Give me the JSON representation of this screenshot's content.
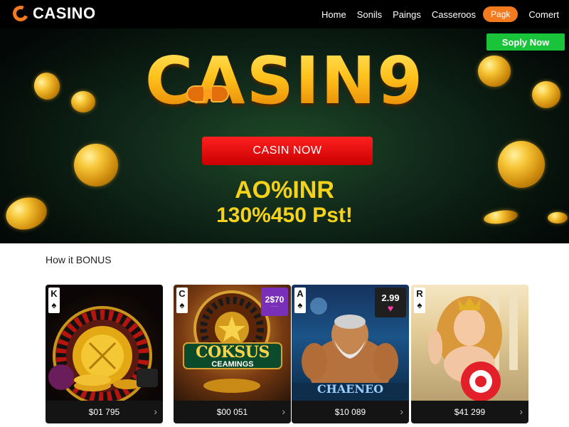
{
  "nav": {
    "brand": "CASINO",
    "links": [
      "Home",
      "Sonils",
      "Paings",
      "Casseroos"
    ],
    "pill": "Pagk",
    "last": "Comert"
  },
  "hero": {
    "title": "CASIN9",
    "apply_label": "Soply Now",
    "cta_label": "CASIN NOW",
    "promo_line1": "AO%INR",
    "promo_line2": "130%450 Pst!"
  },
  "section": {
    "title": "How it BONUS"
  },
  "cards": [
    {
      "tag": "K",
      "amount": "$01 795",
      "theme": "roulette"
    },
    {
      "tag": "C",
      "amount": "$00 051",
      "theme": "cokus",
      "badge": "2$70",
      "art_text": "COKSUS",
      "art_subtext": "CEAMINGS"
    },
    {
      "tag": "A",
      "amount": "$10 089",
      "theme": "zeus",
      "badge": "2.99",
      "art_text": "CHAENEO"
    },
    {
      "tag": "R",
      "amount": "$41 299",
      "theme": "goddess"
    }
  ],
  "colors": {
    "brand": "#f47a20",
    "apply": "#19c43a",
    "cta": "#e10000",
    "gold": "#f6d21a"
  }
}
